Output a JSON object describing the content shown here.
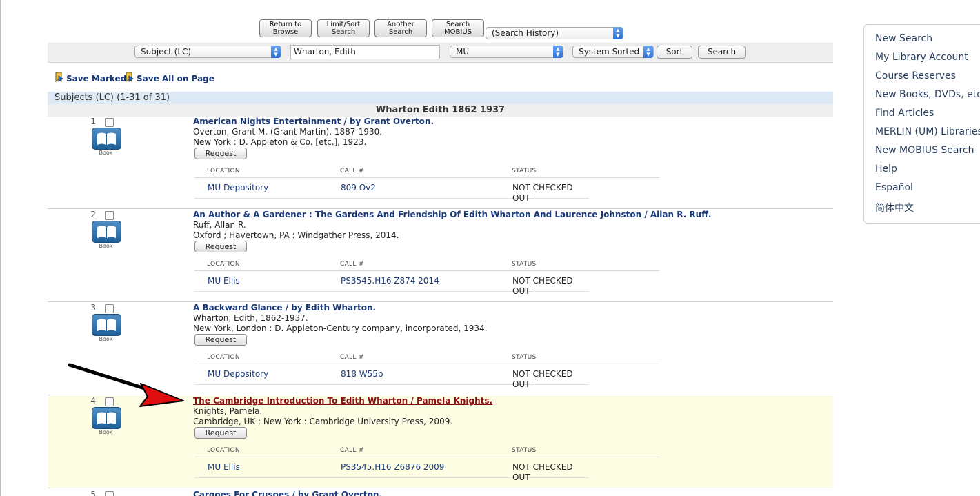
{
  "toolbar": {
    "return_browse": [
      "Return to",
      "Browse"
    ],
    "limit_sort": [
      "Limit/Sort",
      "Search"
    ],
    "another_search": [
      "Another",
      "Search"
    ],
    "search_mobius": [
      "Search",
      "MOBIUS"
    ],
    "history_select": "(Search History)"
  },
  "search": {
    "index": "Subject (LC)",
    "term": "Wharton, Edith",
    "scope": "MU",
    "sort": "System Sorted",
    "sort_button": "Sort",
    "search_button": "Search"
  },
  "save": {
    "marked": "Save Marked",
    "all_on_page": "Save All on Page"
  },
  "results": {
    "subject_header": "Subjects (LC) (1-31 of 31)",
    "heading": "Wharton Edith 1862 1937",
    "holdings_headers": {
      "location": "LOCATION",
      "call": "CALL #",
      "status": "STATUS"
    },
    "book_label": "Book",
    "request_label": "Request",
    "records": [
      {
        "num": "1",
        "title": "American Nights Entertainment / by Grant Overton.",
        "author": "Overton, Grant M. (Grant Martin), 1887-1930.",
        "pub": "New York : D. Appleton & Co. [etc.], 1923.",
        "location": "MU Depository",
        "call": "809 Ov2",
        "status": "NOT CHECKED OUT"
      },
      {
        "num": "2",
        "title": "An Author & A Gardener : The Gardens And Friendship Of Edith Wharton And Laurence Johnston / Allan R. Ruff.",
        "author": "Ruff, Allan R.",
        "pub": "Oxford ; Havertown, PA : Windgather Press, 2014.",
        "location": "MU Ellis",
        "call": "PS3545.H16 Z874 2014",
        "status": "NOT CHECKED OUT"
      },
      {
        "num": "3",
        "title": "A Backward Glance / by Edith Wharton.",
        "author": "Wharton, Edith, 1862-1937.",
        "pub": "New York, London : D. Appleton-Century company, incorporated, 1934.",
        "location": "MU Depository",
        "call": "818 W55b",
        "status": "NOT CHECKED OUT"
      },
      {
        "num": "4",
        "title": "The Cambridge Introduction To Edith Wharton / Pamela Knights.",
        "author": "Knights, Pamela.",
        "pub": "Cambridge, UK ; New York : Cambridge University Press, 2009.",
        "location": "MU Ellis",
        "call": "PS3545.H16 Z6876 2009",
        "status": "NOT CHECKED OUT"
      }
    ],
    "record5": {
      "num": "5",
      "title": "Cargoes For Crusoes / by Grant Overton."
    }
  },
  "sidebar": {
    "items": [
      "New Search",
      "My Library Account",
      "Course Reserves",
      "New Books, DVDs, etc.",
      "Find Articles",
      "MERLIN (UM) Libraries",
      "New MOBIUS Search",
      "Help",
      "Español",
      "简体中文"
    ]
  },
  "colors": {
    "link": "#1a3a7a",
    "highlight_row": "#fdfde4",
    "highlight_title": "#8b1010",
    "subject_bar": "#dde9f4",
    "arrow": "#e01010"
  }
}
